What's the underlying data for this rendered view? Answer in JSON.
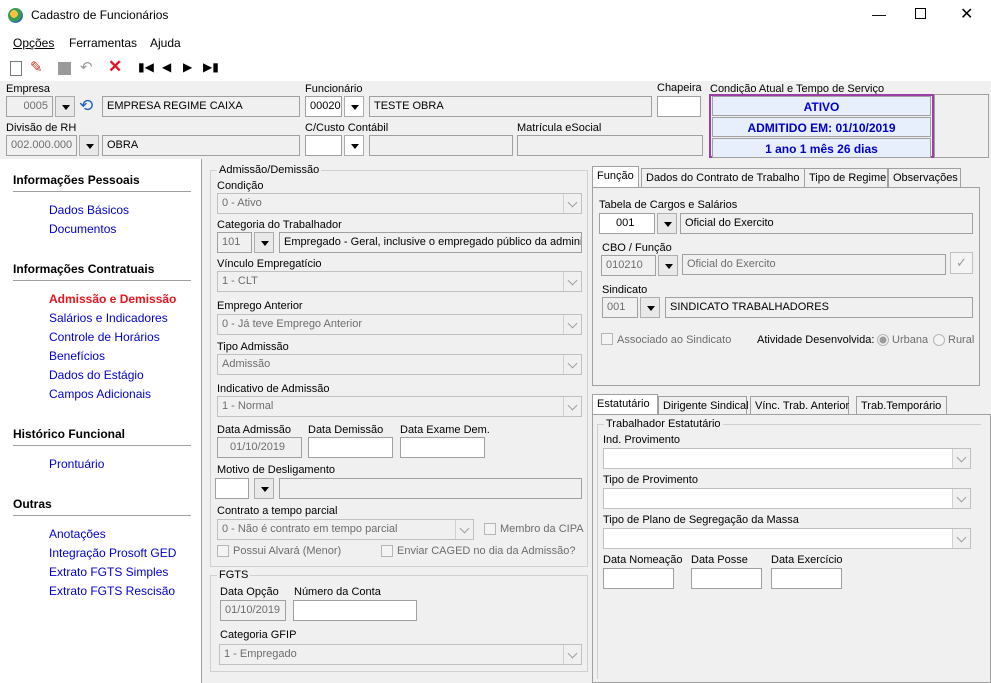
{
  "window": {
    "title": "Cadastro de Funcionários"
  },
  "menu": [
    "Opções",
    "Ferramentas",
    "Ajuda"
  ],
  "header": {
    "empresa_label": "Empresa",
    "empresa_code": "0005",
    "empresa_name": "EMPRESA REGIME CAIXA",
    "funcionario_label": "Funcionário",
    "funcionario_code": "00020",
    "funcionario_name": "TESTE OBRA",
    "chapeira_label": "Chapeira",
    "chapeira_value": "",
    "divisao_label": "Divisão de RH",
    "divisao_code": "002.000.000",
    "divisao_name": "OBRA",
    "custo_label": "C/Custo Contábil",
    "custo_value": "",
    "matricula_label": "Matrícula eSocial",
    "matricula_value": "",
    "condicao_label": "Condição Atual e Tempo de Serviço",
    "status_1": "ATIVO",
    "status_2": "ADMITIDO EM: 01/10/2019",
    "status_3": "1 ano 1 mês 26 dias"
  },
  "sidebar": {
    "sections": [
      {
        "title": "Informações Pessoais",
        "items": [
          "Dados Básicos",
          "Documentos"
        ]
      },
      {
        "title": "Informações Contratuais",
        "items": [
          "Admissão e Demissão",
          "Salários e Indicadores",
          "Controle de Horários",
          "Benefícios",
          "Dados do Estágio",
          "Campos Adicionais"
        ]
      },
      {
        "title": "Histórico Funcional",
        "items": [
          "Prontuário"
        ]
      },
      {
        "title": "Outras",
        "items": [
          "Anotações",
          "Integração Prosoft GED",
          "Extrato FGTS Simples",
          "Extrato FGTS Rescisão"
        ]
      }
    ],
    "active": "Admissão e Demissão"
  },
  "admissao": {
    "group_title": "Admissão/Demissão",
    "condicao_label": "Condição",
    "condicao_value": "0 - Ativo",
    "categoria_label": "Categoria do Trabalhador",
    "categoria_code": "101",
    "categoria_desc": "Empregado - Geral, inclusive o empregado público da administ",
    "vinculo_label": "Vínculo Empregatício",
    "vinculo_value": "1 - CLT",
    "emprego_label": "Emprego Anterior",
    "emprego_value": "0 - Já teve Emprego Anterior",
    "tipo_label": "Tipo Admissão",
    "tipo_value": "Admissão",
    "indicativo_label": "Indicativo de Admissão",
    "indicativo_value": "1 - Normal",
    "data_adm_label": "Data Admissão",
    "data_adm_value": "01/10/2019",
    "data_dem_label": "Data Demissão",
    "data_dem_value": "",
    "data_exame_label": "Data Exame Dem.",
    "data_exame_value": "",
    "motivo_label": "Motivo de Desligamento",
    "contrato_label": "Contrato a tempo parcial",
    "contrato_value": "0 - Não é contrato em tempo parcial",
    "membro_cipa": "Membro da CIPA",
    "alvara": "Possui Alvará (Menor)",
    "caged": "Enviar CAGED no dia da Admissão?"
  },
  "fgts": {
    "group_title": "FGTS",
    "data_opcao_label": "Data Opção",
    "data_opcao_value": "01/10/2019",
    "conta_label": "Número da Conta",
    "conta_value": "",
    "gfip_label": "Categoria GFIP",
    "gfip_value": "1 - Empregado"
  },
  "tabs_top": [
    "Função",
    "Dados do Contrato de Trabalho",
    "Tipo de Regime",
    "Observações"
  ],
  "funcao": {
    "tabela_label": "Tabela de Cargos e Salários",
    "tabela_code": "001",
    "tabela_desc": "Oficial do Exercito",
    "cbo_label": "CBO / Função",
    "cbo_code": "010210",
    "cbo_desc": "Oficial do Exercito",
    "sindicato_label": "Sindicato",
    "sindicato_code": "001",
    "sindicato_desc": "SINDICATO TRABALHADORES",
    "associado": "Associado ao Sindicato",
    "atividade_label": "Atividade Desenvolvida:",
    "urbana": "Urbana",
    "rural": "Rural"
  },
  "tabs_bottom": [
    "Estatutário",
    "Dirigente Sindical",
    "Vínc. Trab. Anterior",
    "Trab.Temporário"
  ],
  "estatutario": {
    "group_title": "Trabalhador Estatutário",
    "ind_label": "Ind. Provimento",
    "tipo_prov_label": "Tipo de Provimento",
    "plano_label": "Tipo de Plano de Segregação da Massa",
    "nomeacao_label": "Data Nomeação",
    "posse_label": "Data Posse",
    "exercicio_label": "Data Exercício"
  },
  "colors": {
    "accent": "#0000cc",
    "active_link": "#e8141e",
    "status_border": "#9b3fa6"
  }
}
